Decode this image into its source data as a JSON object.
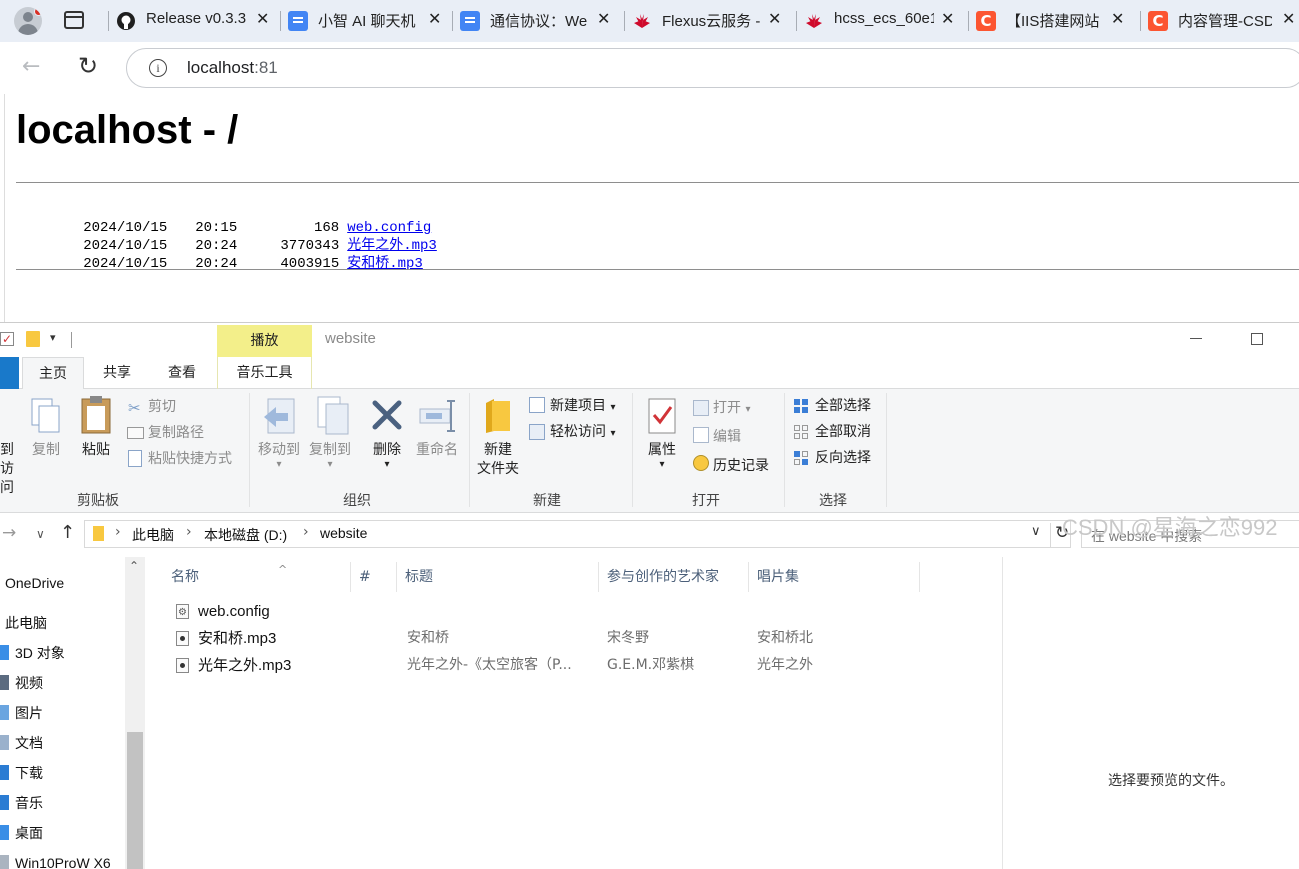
{
  "browser": {
    "tabs": [
      {
        "title": "Release v0.3.3",
        "favicon": "github-icon"
      },
      {
        "title": "小智 AI 聊天机",
        "favicon": "docs-icon"
      },
      {
        "title": "通信协议：We",
        "favicon": "docs-icon"
      },
      {
        "title": "Flexus云服务 -",
        "favicon": "huawei-icon"
      },
      {
        "title": "hcss_ecs_60e1",
        "favicon": "huawei-icon"
      },
      {
        "title": "【IIS搭建网站",
        "favicon": "csdn-icon"
      },
      {
        "title": "内容管理-CSD",
        "favicon": "csdn-icon"
      }
    ],
    "tab_close": "✕",
    "url_host": "localhost",
    "url_port": ":81"
  },
  "page": {
    "title": "localhost - /",
    "listing": [
      {
        "date": "2024/10/15",
        "time": "20:15",
        "size": "168",
        "name": "web.config"
      },
      {
        "date": "2024/10/15",
        "time": "20:24",
        "size": "3770343",
        "name": "光年之外.mp3"
      },
      {
        "date": "2024/10/15",
        "time": "20:24",
        "size": "4003915",
        "name": "安和桥.mp3"
      }
    ]
  },
  "explorer": {
    "window_title": "website",
    "context_tab": "播放",
    "tabs": {
      "home": "主页",
      "share": "共享",
      "view": "查看",
      "music_tools": "音乐工具"
    },
    "ribbon": {
      "clipboard": {
        "pin_top": "到",
        "pin_bottom": "访问",
        "copy": "复制",
        "paste": "粘贴",
        "cut": "剪切",
        "copy_path": "复制路径",
        "paste_shortcut": "粘贴快捷方式",
        "label": "剪贴板"
      },
      "organize": {
        "move_to": "移动到",
        "copy_to": "复制到",
        "delete": "删除",
        "rename": "重命名",
        "label": "组织"
      },
      "new": {
        "new_folder_1": "新建",
        "new_folder_2": "文件夹",
        "new_item": "新建项目",
        "easy_access": "轻松访问",
        "label": "新建"
      },
      "open": {
        "properties": "属性",
        "open": "打开",
        "edit": "编辑",
        "history": "历史记录",
        "label": "打开"
      },
      "select": {
        "select_all": "全部选择",
        "select_none": "全部取消",
        "invert": "反向选择",
        "label": "选择"
      }
    },
    "address": {
      "crumbs": [
        "此电脑",
        "本地磁盘 (D:)",
        "website"
      ],
      "search_placeholder": "在 website 中搜索"
    },
    "nav": [
      {
        "label": "OneDrive"
      },
      {
        "label": "此电脑"
      },
      {
        "label": "3D 对象"
      },
      {
        "label": "视频"
      },
      {
        "label": "图片"
      },
      {
        "label": "文档"
      },
      {
        "label": "下载"
      },
      {
        "label": "音乐"
      },
      {
        "label": "桌面"
      },
      {
        "label": "Win10ProW X6"
      }
    ],
    "columns": {
      "name": "名称",
      "number": "#",
      "title": "标题",
      "artist": "参与创作的艺术家",
      "album": "唱片集"
    },
    "files": [
      {
        "name": "web.config",
        "title": "",
        "artist": "",
        "album": "",
        "type": "config"
      },
      {
        "name": "安和桥.mp3",
        "title": "安和桥",
        "artist": "宋冬野",
        "album": "安和桥北",
        "type": "audio"
      },
      {
        "name": "光年之外.mp3",
        "title": "光年之外-《太空旅客（P...",
        "artist": "G.E.M.邓紫棋",
        "album": "光年之外",
        "type": "audio"
      }
    ],
    "preview_text": "选择要预览的文件。"
  },
  "watermark": "CSDN @星海之恋992",
  "colors": {
    "link": "#0000ee",
    "file_tab": "#1979ca",
    "context_tab": "#f3ef8a",
    "csdn": "#fc5531",
    "docs": "#4285f4"
  }
}
